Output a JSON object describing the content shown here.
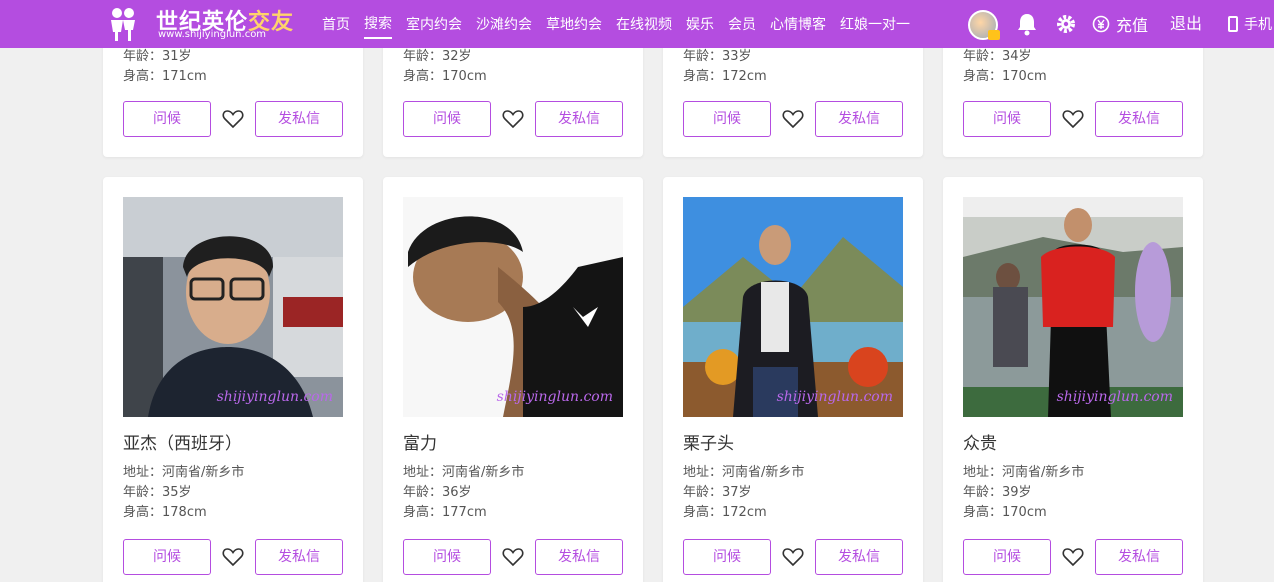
{
  "brand": {
    "title_main": "世纪英伦",
    "title_accent": "交友",
    "url": "www.shijiyinglun.com"
  },
  "nav": {
    "items": [
      "首页",
      "搜索",
      "室内约会",
      "沙滩约会",
      "草地约会",
      "在线视频",
      "娱乐",
      "会员",
      "心情博客",
      "红娘一对一"
    ],
    "active_index": 1
  },
  "tools": {
    "recharge": "充值",
    "logout": "退出",
    "mobile": "手机"
  },
  "card_buttons": {
    "greet": "问候",
    "message": "发私信"
  },
  "watermark": "shijiyinglun.com",
  "top_profiles": [
    {
      "age": "年龄：31岁",
      "height": "身高：171cm"
    },
    {
      "age": "年龄：32岁",
      "height": "身高：170cm"
    },
    {
      "age": "年龄：33岁",
      "height": "身高：172cm"
    },
    {
      "age": "年龄：34岁",
      "height": "身高：170cm"
    }
  ],
  "profiles": [
    {
      "name": "亚杰（西班牙）",
      "address": "地址：河南省/新乡市",
      "age": "年龄：35岁",
      "height": "身高：178cm"
    },
    {
      "name": "富力",
      "address": "地址：河南省/新乡市",
      "age": "年龄：36岁",
      "height": "身高：177cm"
    },
    {
      "name": "栗子头",
      "address": "地址：河南省/新乡市",
      "age": "年龄：37岁",
      "height": "身高：172cm"
    },
    {
      "name": "众贵",
      "address": "地址：河南省/新乡市",
      "age": "年龄：39岁",
      "height": "身高：170cm"
    }
  ],
  "colors": {
    "brand": "#b44de0",
    "accent": "#ffd36b",
    "background": "#f0f0f0"
  }
}
